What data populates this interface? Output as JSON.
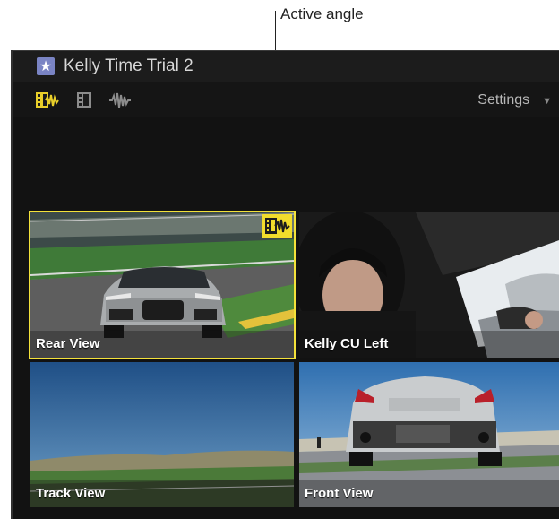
{
  "callout": {
    "text": "Active angle"
  },
  "viewer": {
    "title": "Kelly Time Trial 2",
    "toolbar": {
      "settings_label": "Settings",
      "icons": [
        "video-and-audio-icon",
        "video-only-icon",
        "audio-only-icon"
      ]
    },
    "angles": [
      {
        "label": "Rear View",
        "active": true
      },
      {
        "label": "Kelly CU Left",
        "active": false
      },
      {
        "label": "Track View",
        "active": false
      },
      {
        "label": "Front View",
        "active": false
      }
    ]
  },
  "colors": {
    "active_highlight": "#f4e23a",
    "background": "#121212"
  }
}
